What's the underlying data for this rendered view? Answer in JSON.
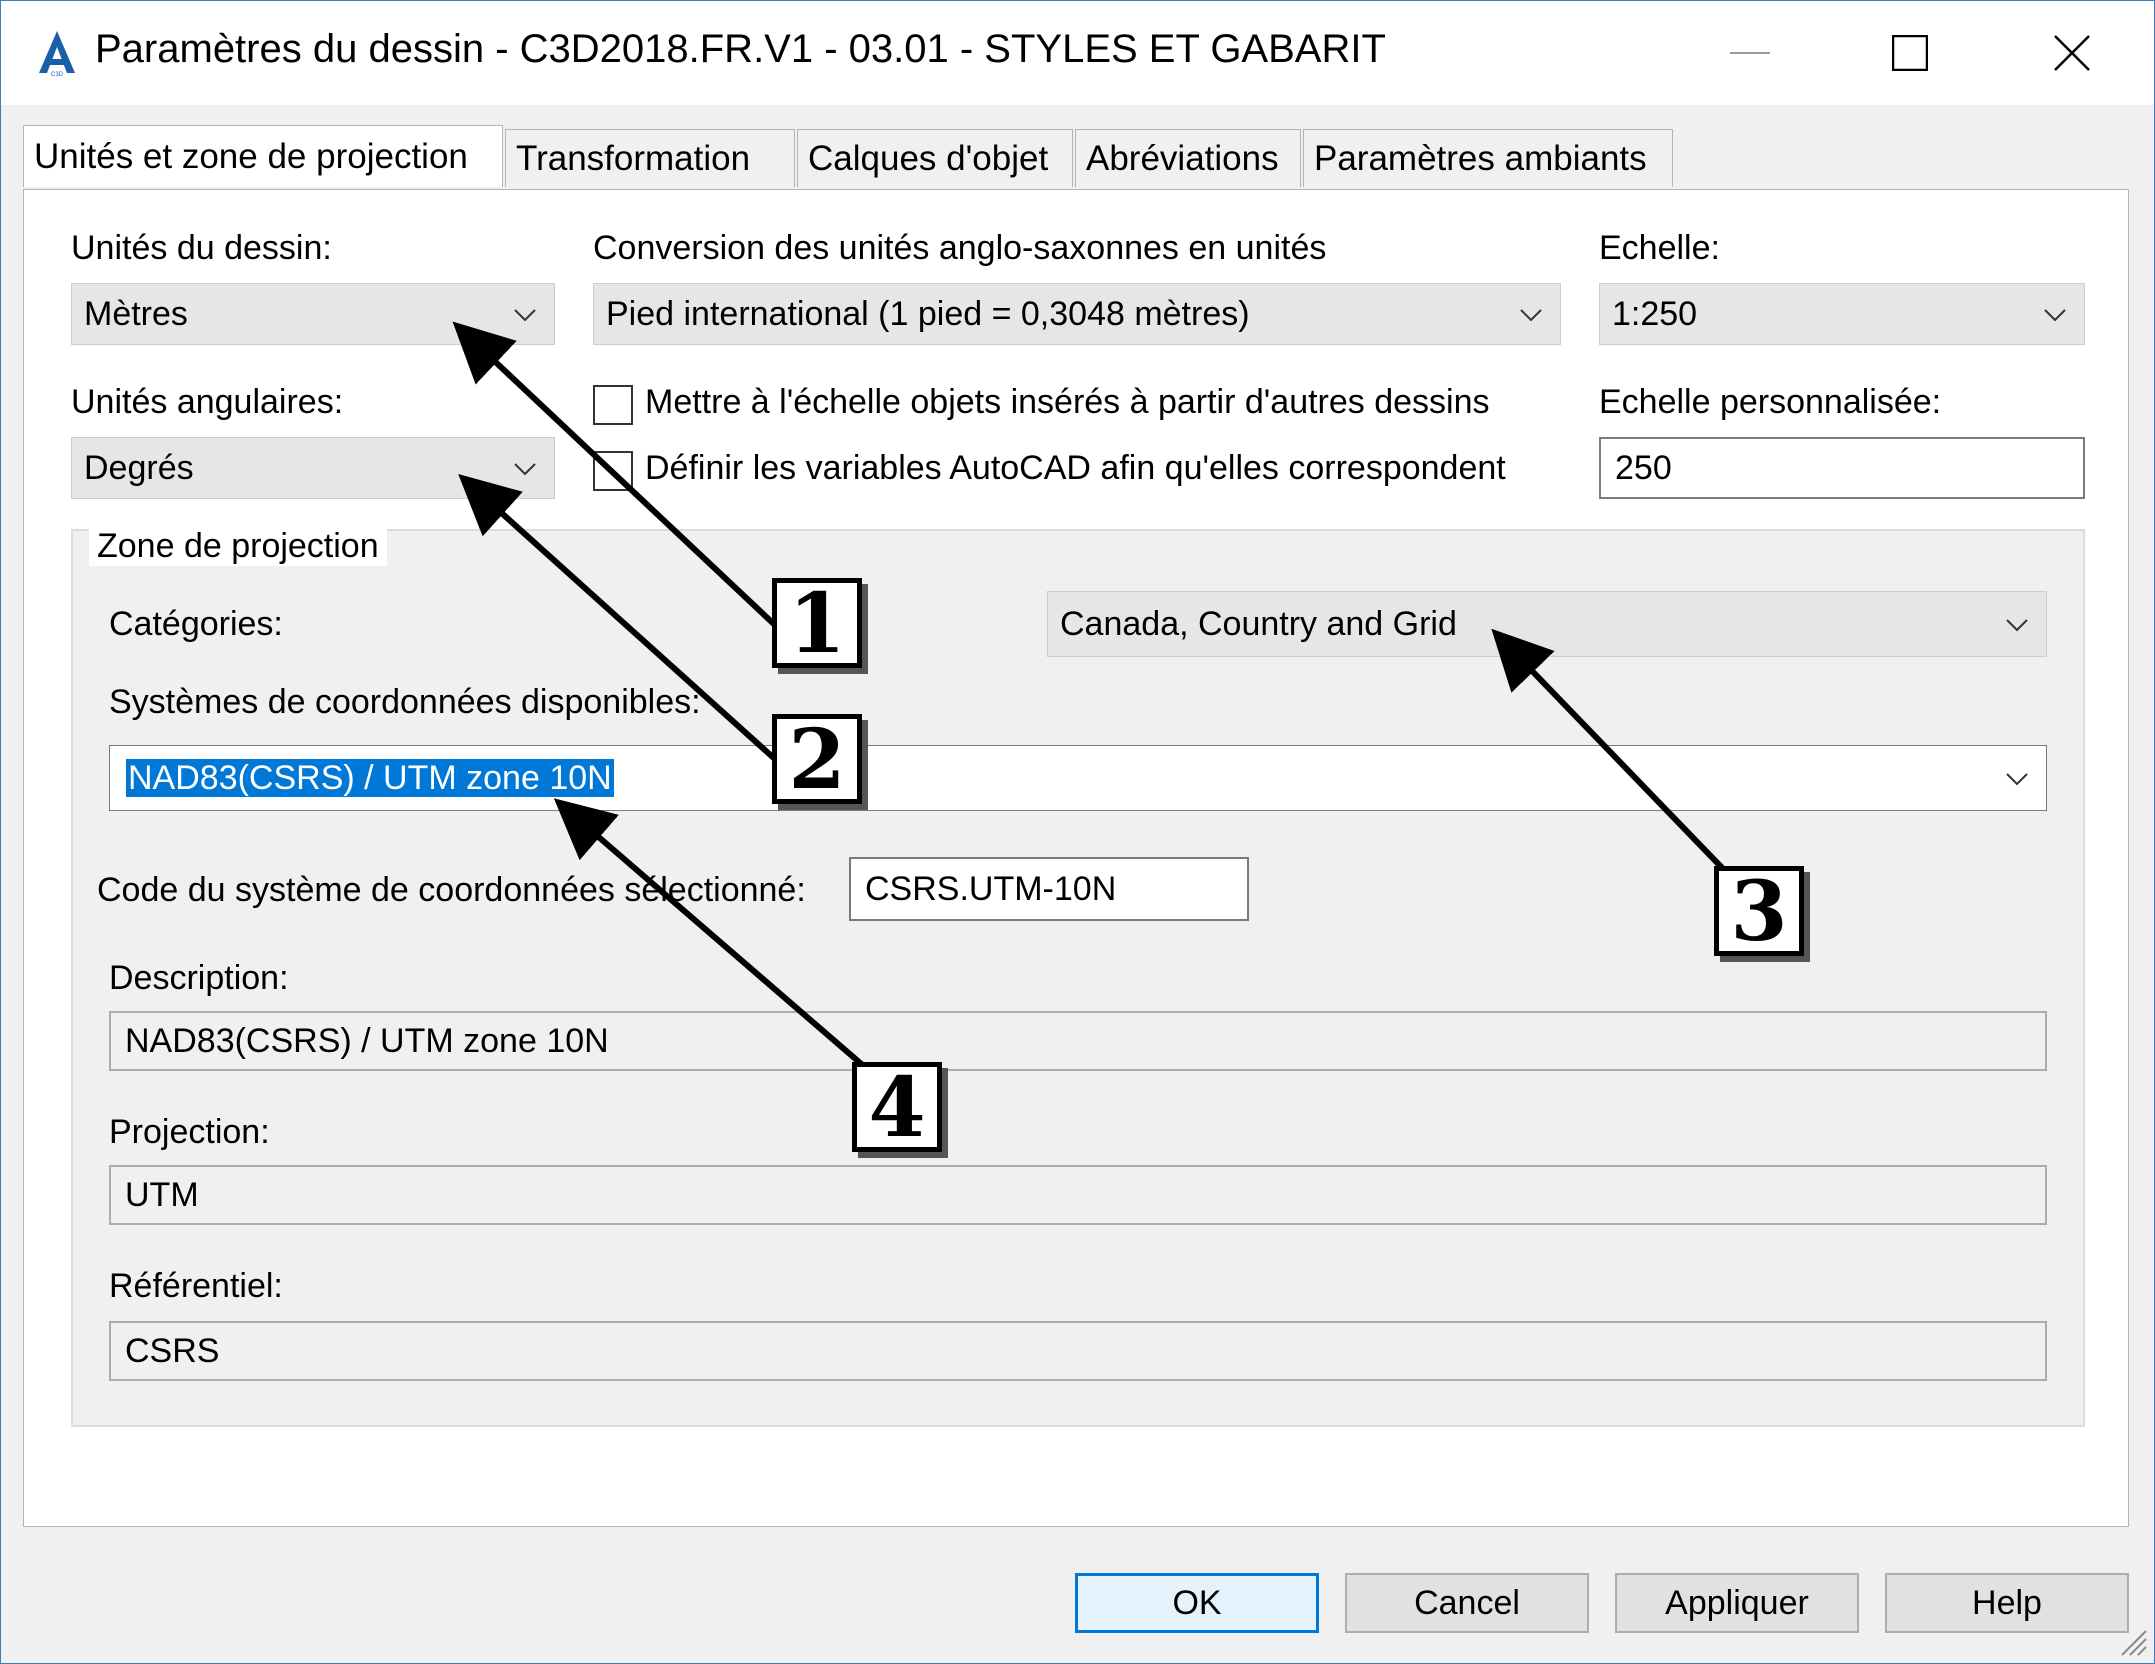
{
  "window": {
    "title": "Paramètres du dessin - C3D2018.FR.V1 - 03.01 - STYLES ET GABARIT",
    "app_icon": "autocad-icon",
    "app_icon_letter": "A"
  },
  "tabs": [
    {
      "label": "Unités et zone de projection",
      "active": true
    },
    {
      "label": "Transformation",
      "active": false
    },
    {
      "label": "Calques d'objet",
      "active": false
    },
    {
      "label": "Abréviations",
      "active": false
    },
    {
      "label": "Paramètres ambiants",
      "active": false
    }
  ],
  "units": {
    "drawing_units_label": "Unités du dessin:",
    "drawing_units_value": "Mètres",
    "conversion_label": "Conversion des unités anglo-saxonnes en unités",
    "conversion_value": "Pied international (1 pied = 0,3048 mètres)",
    "scale_label": "Echelle:",
    "scale_value": "1:250",
    "angular_units_label": "Unités angulaires:",
    "angular_units_value": "Degrés",
    "scale_inserted_label": "Mettre à l'échelle objets insérés à partir d'autres dessins",
    "scale_inserted_checked": false,
    "set_variables_label": "Définir les variables AutoCAD afin qu'elles correspondent",
    "set_variables_checked": false,
    "custom_scale_label": "Echelle personnalisée:",
    "custom_scale_value": "250"
  },
  "zone": {
    "group_label": "Zone de projection",
    "categories_label": "Catégories:",
    "categories_value": "Canada, Country and Grid",
    "available_systems_label": "Systèmes de coordonnées disponibles:",
    "available_systems_value": "NAD83(CSRS) / UTM zone 10N",
    "code_label": "Code du système de coordonnées sélectionné:",
    "code_value": "CSRS.UTM-10N",
    "description_label": "Description:",
    "description_value": "NAD83(CSRS) / UTM zone 10N",
    "projection_label": "Projection:",
    "projection_value": "UTM",
    "datum_label": "Référentiel:",
    "datum_value": "CSRS"
  },
  "buttons": {
    "ok": "OK",
    "cancel": "Cancel",
    "apply": "Appliquer",
    "help": "Help"
  },
  "callouts": [
    "1",
    "2",
    "3",
    "4"
  ],
  "colors": {
    "selection": "#0078d7",
    "window_border": "#3d7cc4"
  }
}
